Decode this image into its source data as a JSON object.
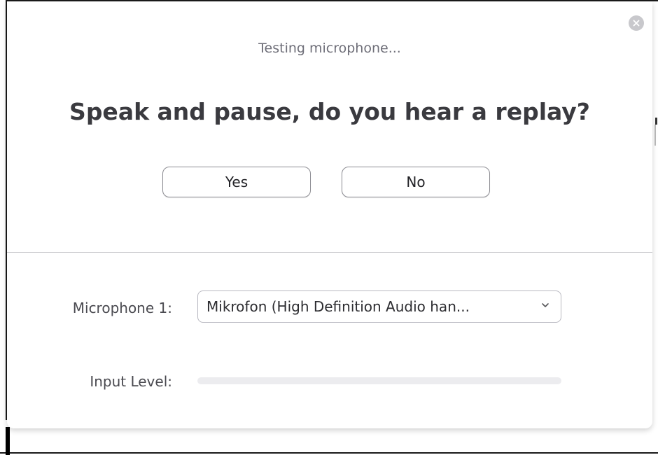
{
  "dialog": {
    "subtitle": "Testing microphone...",
    "question": "Speak and pause, do you hear a replay?",
    "close_icon": "close-icon"
  },
  "buttons": {
    "yes_label": "Yes",
    "no_label": "No"
  },
  "microphone": {
    "label": "Microphone 1:",
    "selected": "Mikrofon (High Definition Audio han...",
    "dropdown_icon": "chevron-down-icon"
  },
  "input_level": {
    "label": "Input Level:",
    "level_percent": 0
  },
  "colors": {
    "close_bg": "#c8c8cc",
    "text_dark": "#3a3a3f",
    "text_muted": "#6e6e78",
    "divider": "#c8c8cc",
    "level_track": "#ececef"
  }
}
